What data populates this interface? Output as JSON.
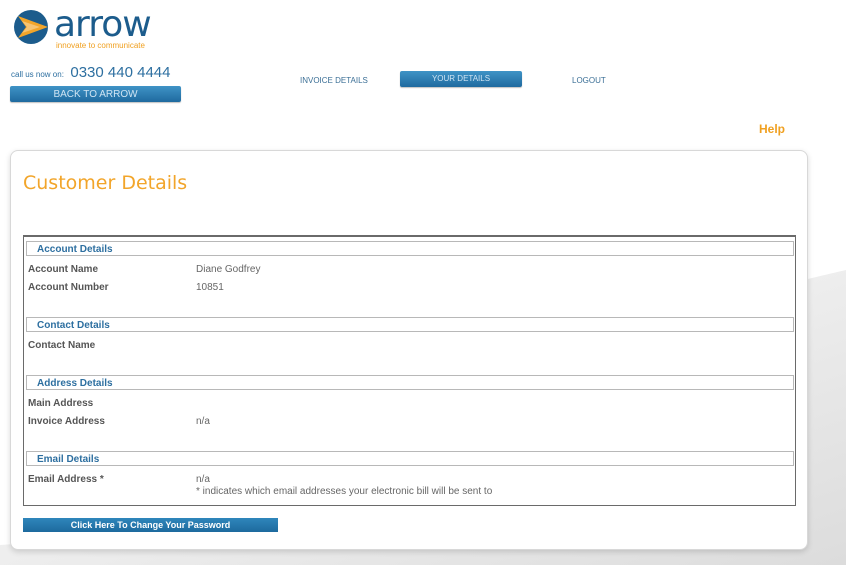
{
  "brand": {
    "name": "arrow",
    "tagline": "innovate to communicate",
    "colors": {
      "primary_blue": "#1c5c8c",
      "accent_orange": "#f2a52a"
    }
  },
  "contact": {
    "call_label": "call us now on:",
    "phone": "0330 440 4444"
  },
  "header": {
    "back_button": "BACK TO ARROW",
    "nav": {
      "invoice_details": "INVOICE DETAILS",
      "your_details": "YOUR DETAILS",
      "logout": "LOGOUT"
    },
    "help": "Help"
  },
  "page": {
    "title": "Customer Details",
    "sections": {
      "account": {
        "heading": "Account Details",
        "account_name_label": "Account Name",
        "account_name_value": "Diane Godfrey",
        "account_number_label": "Account Number",
        "account_number_value": "10851"
      },
      "contact": {
        "heading": "Contact Details",
        "contact_name_label": "Contact Name"
      },
      "address": {
        "heading": "Address Details",
        "main_address_label": "Main Address",
        "invoice_address_label": "Invoice Address",
        "invoice_address_value": "n/a"
      },
      "email": {
        "heading": "Email Details",
        "email_label": "Email Address *",
        "email_value": "n/a",
        "email_note": "* indicates which email addresses your electronic bill will be sent to"
      }
    },
    "change_password_button": "Click Here To Change Your Password"
  }
}
